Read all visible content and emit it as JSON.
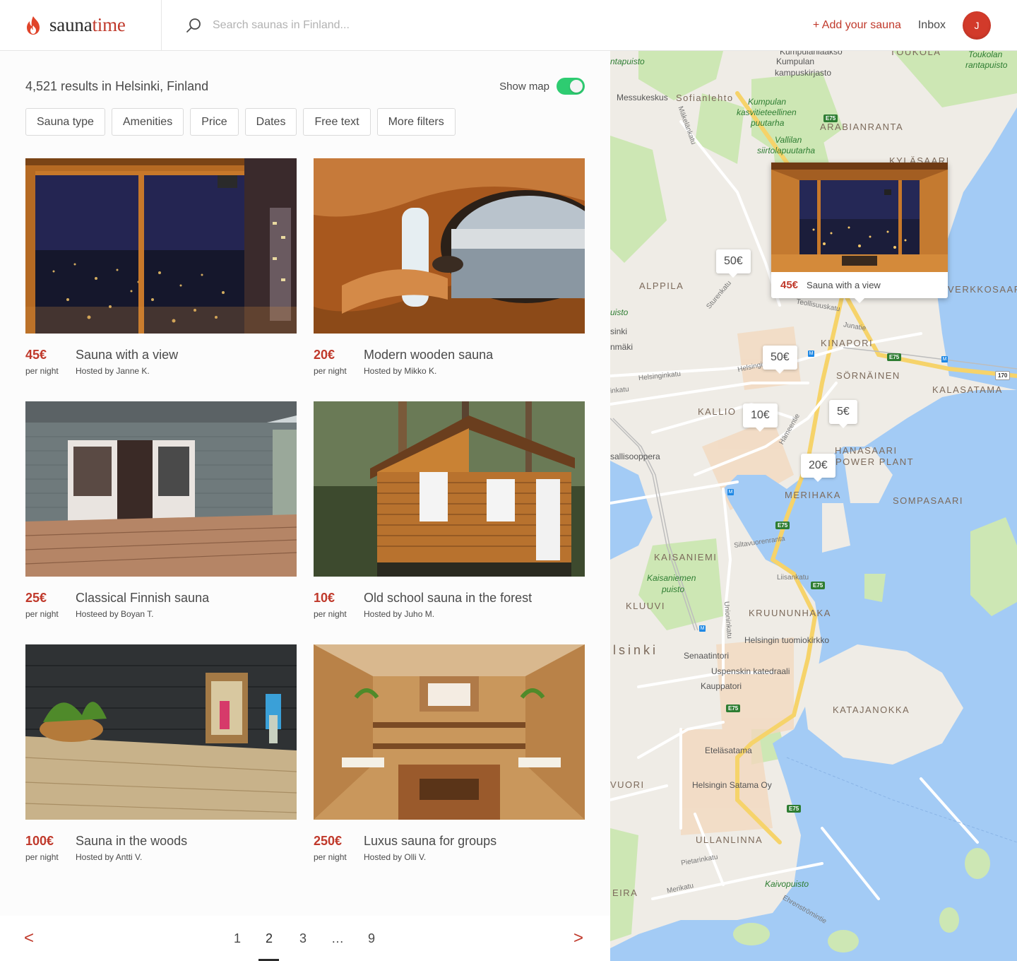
{
  "app": {
    "logo_part1": "sauna",
    "logo_part2": "time"
  },
  "search": {
    "placeholder": "Search saunas in Finland..."
  },
  "nav": {
    "add_sauna": "+ Add your sauna",
    "inbox": "Inbox",
    "avatar_initial": "J"
  },
  "results": {
    "title": "4,521 results in Helsinki, Finland",
    "show_map_label": "Show map",
    "show_map_on": true
  },
  "filters": [
    "Sauna type",
    "Amenities",
    "Price",
    "Dates",
    "Free text",
    "More filters"
  ],
  "listings": [
    {
      "price": "45€",
      "per": "per night",
      "title": "Sauna with a view",
      "host": "Hosted by Janne K."
    },
    {
      "price": "20€",
      "per": "per night",
      "title": "Modern wooden sauna",
      "host": "Hosted by Mikko K."
    },
    {
      "price": "25€",
      "per": "per night",
      "title": "Classical Finnish sauna",
      "host": "Hosteed by Boyan T."
    },
    {
      "price": "10€",
      "per": "per night",
      "title": "Old school sauna in the forest",
      "host": "Hosted by Juho M."
    },
    {
      "price": "100€",
      "per": "per night",
      "title": "Sauna in the woods",
      "host": "Hosted by Antti V."
    },
    {
      "price": "250€",
      "per": "per night",
      "title": "Luxus sauna for groups",
      "host": "Hosted by Olli V."
    }
  ],
  "pagination": {
    "prev": "<",
    "next": ">",
    "pages": [
      "1",
      "2",
      "3",
      "…",
      "9"
    ],
    "current": "2"
  },
  "map": {
    "pins": [
      "50€",
      "50€",
      "10€",
      "5€",
      "20€"
    ],
    "popup": {
      "price": "45€",
      "title": "Sauna with a view"
    },
    "labels": {
      "kumpula_district": "Kumpulan",
      "kumpulanlaakso": "Kumpulanlaakso",
      "kumpula_library": "kampuskirjasto",
      "toukola": "TOUKOLA",
      "toukolan": "Toukolan",
      "rantapuisto": "rantapuisto",
      "messukeskus": "Messukeskus",
      "sofianlehto": "Sofianlehto",
      "kumpulan_garden": "Kumpulan",
      "kasvitieteellinen": "kasvitieteellinen",
      "puutarha": "puutarha",
      "arabianranta": "ARABIANRANTA",
      "vallilan": "Vallilan",
      "siirtolapuutarha": "siirtolapuutarha",
      "kylasaari": "KYLÄSAARI",
      "alppila": "ALPPILA",
      "verkkosaari": "VERKKOSAARI",
      "kinapori": "KINAPORI",
      "sornainen": "SÖRNÄINEN",
      "kalasatama": "KALASATAMA",
      "kallio": "KALLIO",
      "hanasaari": "HANASAARI",
      "power_plant": "POWER PLANT",
      "merihaka": "MERIHAKA",
      "sompasaari": "SOMPASAARI",
      "kaisaniemi": "KAISANIEMI",
      "kaisaniemen": "Kaisaniemen",
      "puisto": "puisto",
      "kluuvi": "KLUUVI",
      "kruununhaka": "KRUUNUNHAKA",
      "tuomiokirkko": "Helsingin tuomiokirkko",
      "senaatintori": "Senaatintori",
      "uspenskin": "Uspenskin katedraali",
      "kauppatori": "Kauppatori",
      "katajanokka": "KATAJANOKKA",
      "etelasatama": "Eteläsatama",
      "satama_oy": "Helsingin Satama Oy",
      "ullanlinna": "ULLANLINNA",
      "kaivopuisto": "Kaivopuisto",
      "sallisooppera": "sallisooppera",
      "helsinki_city": "lsinki",
      "ntapuisto": "ntapuisto",
      "vuori": "VUORI",
      "eira": "EIRA",
      "teollisuuskatu": "Teollisuuskatu",
      "junatie": "Junatie",
      "helsinginkatu": "Helsinginkatu",
      "helsinginkatu2": "Helsinginkatu",
      "hameentie": "Hämeentie",
      "sturenkatu": "Sturenkatu",
      "makelankatu": "Mäkelänkatu",
      "siltavuorenranta": "Siltavuorenranta",
      "liisankatu": "Liisankatu",
      "unioninkatu": "Unioninkatu",
      "pietarinkatu": "Pietarinkatu",
      "merikatu": "Merikatu",
      "ehrenstromintie": "Ehrenströmintie",
      "uisto": "uisto",
      "sinki": "sinki",
      "nmaki": "nmäki",
      "kinkatu": "inkatu"
    },
    "road_badges": [
      "E75",
      "E75",
      "E75",
      "E75",
      "E75",
      "E75",
      "170"
    ]
  }
}
